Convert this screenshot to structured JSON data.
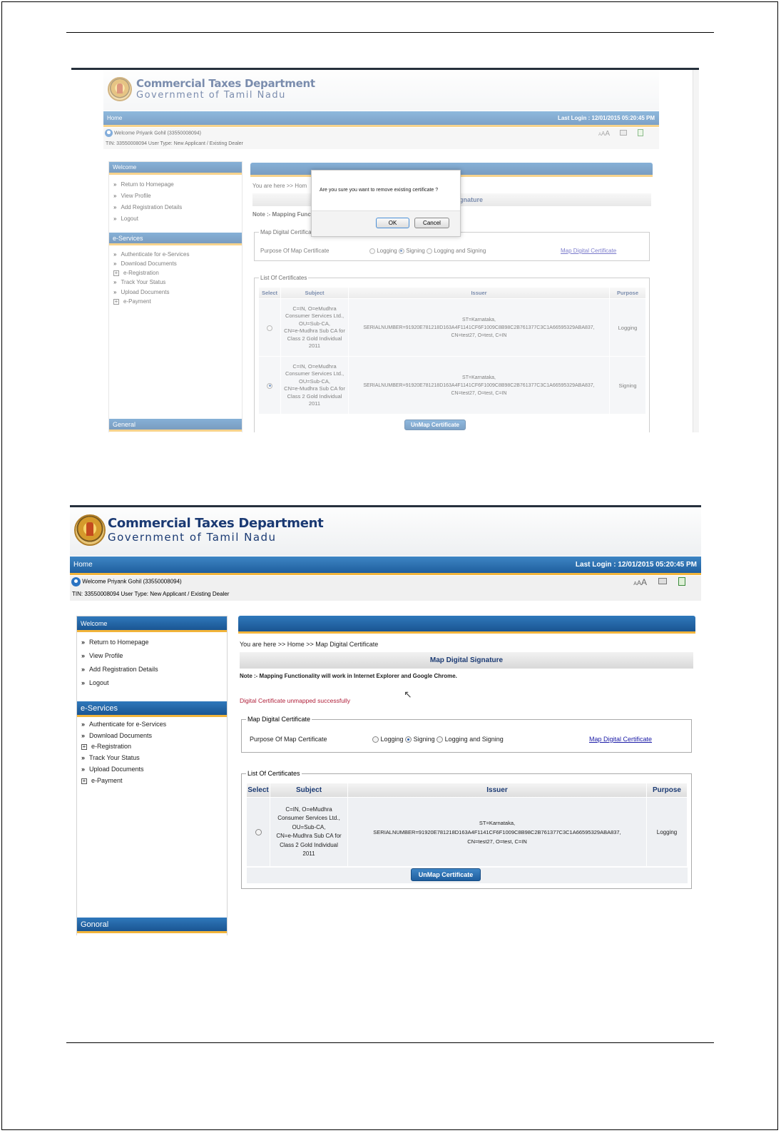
{
  "shared": {
    "brand_title": "Commercial Taxes Department",
    "brand_subtitle": "Government of Tamil Nadu",
    "nav_home": "Home",
    "last_login": "Last Login : 12/01/2015 05:20:45 PM",
    "welcome_text": "Welcome Priyank Gohil (33550008094)",
    "tin_line": "TIN: 33550008094   User Type: New Applicant / Existing Dealer",
    "font_size_controls": [
      "A",
      "A",
      "A"
    ],
    "sidebar": {
      "welcome_header": "Welcome",
      "welcome_links": [
        "Return to Homepage",
        "View Profile",
        "Add Registration Details",
        "Logout"
      ],
      "eservices_header": "e-Services",
      "eservices_links": [
        {
          "label": "Authenticate for e-Services",
          "expandable": false
        },
        {
          "label": "Download Documents",
          "expandable": false
        },
        {
          "label": "e-Registration",
          "expandable": true
        },
        {
          "label": "Track Your Status",
          "expandable": false
        },
        {
          "label": "Upload Documents",
          "expandable": false
        },
        {
          "label": "e-Payment",
          "expandable": true
        }
      ],
      "general_header_top": "General",
      "general_header_bottom": "Gonoral"
    },
    "breadcrumb_full": "You are here >> Home >> Map Digital Certificate",
    "breadcrumb_partial": "You are here >> Hom",
    "page_title": "Map Digital Signature",
    "page_title_partial": "gnature",
    "note_full": "Note :-  Mapping Functionality will work in Internet Explorer and Google Chrome.",
    "note_partial": "Note :-  Mapping Functi",
    "success_message": "Digital Certificate unmapped successfully",
    "map_box": {
      "legend": "Map Digital Certificate",
      "legend_partial": "Map Digital Certifica",
      "label": "Purpose Of Map Certificate",
      "options": [
        "Logging",
        "Signing",
        "Logging and Signing"
      ],
      "selected": "Signing",
      "link": "Map Digital Certificate"
    },
    "list_box": {
      "legend": "List Of Certificates",
      "headers": [
        "Select",
        "Subject",
        "Issuer",
        "Purpose"
      ],
      "subject_lines": [
        "C=IN, O=eMudhra",
        "Consumer Services Ltd.,",
        "OU=Sub-CA,",
        "CN=e-Mudhra Sub CA for",
        "Class 2 Gold Individual",
        "2011"
      ],
      "issuer_lines": [
        "ST=Karnataka,",
        "SERIALNUMBER=91920E781218D163A4F1141CF6F1009C8B98C2B761377C3C1A66595329ABA837,",
        "CN=test27, O=test, C=IN"
      ],
      "unmap_button": "UnMap Certificate"
    }
  },
  "top_screenshot": {
    "rows": [
      {
        "purpose": "Logging",
        "selected": false
      },
      {
        "purpose": "Signing",
        "selected": true
      }
    ],
    "dialog": {
      "message": "Are you sure you want to remove existing certificate ?",
      "ok": "OK",
      "cancel": "Cancel"
    }
  },
  "bottom_screenshot": {
    "rows": [
      {
        "purpose": "Logging",
        "selected": false
      }
    ]
  },
  "colors": {
    "nav_blue": "#1f5e9e",
    "accent_gold": "#f2b43a",
    "brand_navy": "#1b3a73",
    "success_red": "#b0203a",
    "link_blue": "#1a1aa6"
  }
}
